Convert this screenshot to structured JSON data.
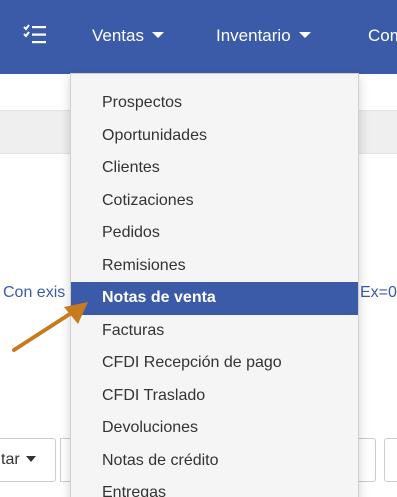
{
  "topbar": {
    "menu_icon": "checklist-menu-icon",
    "nav": [
      {
        "label": "Ventas",
        "has_caret": true
      },
      {
        "label": "Inventario",
        "has_caret": true
      },
      {
        "label": "Com",
        "has_caret": false
      }
    ]
  },
  "page": {
    "filter_left": "Con exis",
    "filter_right": "Ex=0",
    "bottom_button": "tar"
  },
  "dropdown": {
    "items": [
      {
        "label": "Prospectos",
        "active": false
      },
      {
        "label": "Oportunidades",
        "active": false
      },
      {
        "label": "Clientes",
        "active": false
      },
      {
        "label": "Cotizaciones",
        "active": false
      },
      {
        "label": "Pedidos",
        "active": false
      },
      {
        "label": "Remisiones",
        "active": false
      },
      {
        "label": "Notas de venta",
        "active": true
      },
      {
        "label": "Facturas",
        "active": false
      },
      {
        "label": "CFDI Recepción de pago",
        "active": false
      },
      {
        "label": "CFDI Traslado",
        "active": false
      },
      {
        "label": "Devoluciones",
        "active": false
      },
      {
        "label": "Notas de crédito",
        "active": false
      },
      {
        "label": "Entregas",
        "active": false
      }
    ]
  },
  "colors": {
    "brand": "#3b5ba9",
    "annotation_arrow": "#c87a1e",
    "dropdown_bg": "#f5f5f5"
  },
  "annotation": {
    "icon": "pointer-arrow-icon"
  }
}
